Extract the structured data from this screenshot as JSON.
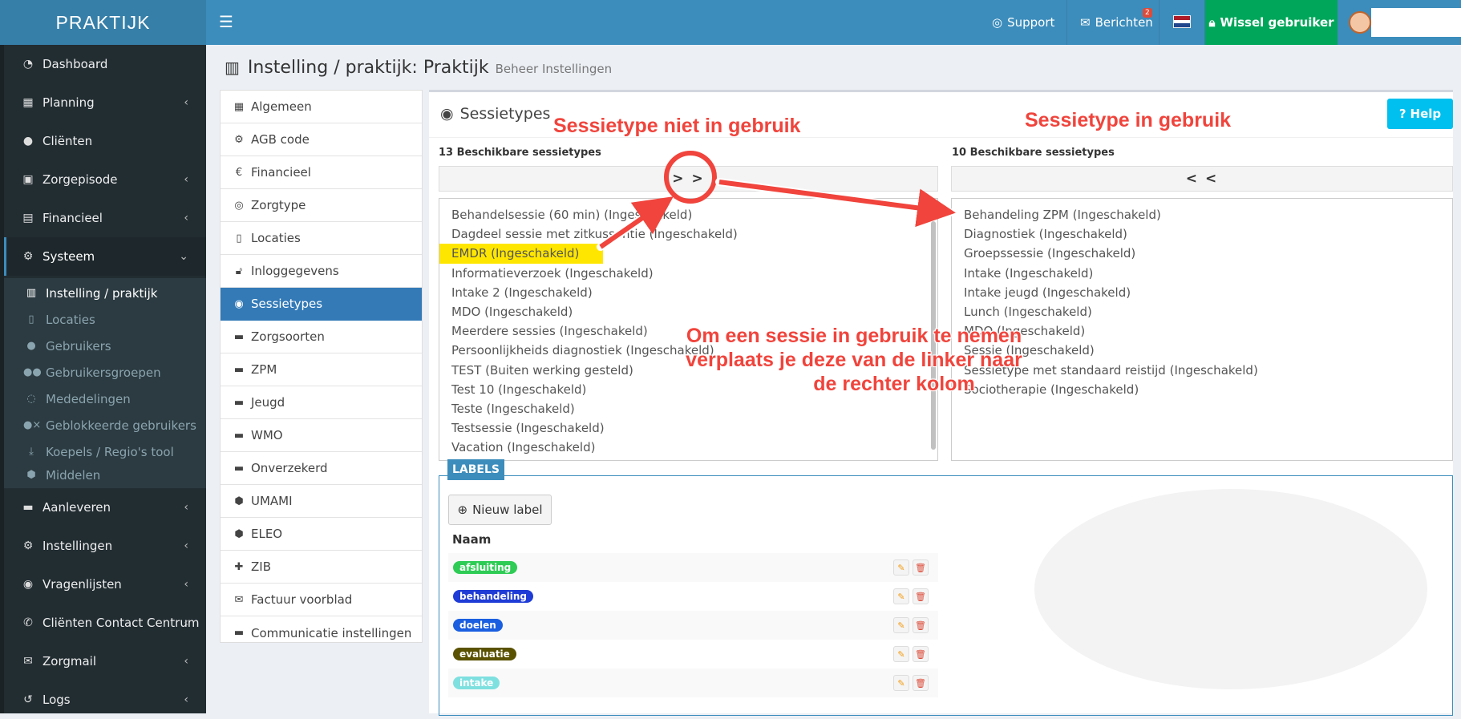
{
  "app": {
    "logo": "PRAKTIJK"
  },
  "topbar": {
    "support": "Support",
    "messages": "Berichten",
    "messages_badge": "2",
    "switch_user": "Wissel gebruiker"
  },
  "sidebar": {
    "items": [
      {
        "label": "Dashboard",
        "icon": "dashboard-icon"
      },
      {
        "label": "Planning",
        "icon": "calendar-icon"
      },
      {
        "label": "Cliënten",
        "icon": "user-icon"
      },
      {
        "label": "Zorgepisode",
        "icon": "briefcase-icon"
      },
      {
        "label": "Financieel",
        "icon": "book-icon"
      },
      {
        "label": "Systeem",
        "icon": "gears-icon"
      },
      {
        "label": "Aanleveren",
        "icon": "truck-icon"
      },
      {
        "label": "Instellingen",
        "icon": "gear-icon"
      },
      {
        "label": "Vragenlijsten",
        "icon": "globe-icon"
      },
      {
        "label": "Cliënten Contact Centrum",
        "icon": "phone-icon"
      },
      {
        "label": "Zorgmail",
        "icon": "envelope-icon"
      },
      {
        "label": "Logs",
        "icon": "history-icon"
      }
    ],
    "submenu": [
      {
        "label": "Instelling / praktijk",
        "icon": "building-icon"
      },
      {
        "label": "Locaties",
        "icon": "map-icon"
      },
      {
        "label": "Gebruikers",
        "icon": "user-icon"
      },
      {
        "label": "Gebruikersgroepen",
        "icon": "users-icon"
      },
      {
        "label": "Mededelingen",
        "icon": "comment-icon"
      },
      {
        "label": "Geblokkeerde gebruikers",
        "icon": "user-times-icon"
      },
      {
        "label": "Koepels / Regio's tool",
        "icon": "download-icon"
      },
      {
        "label": "Middelen",
        "icon": "cubes-icon"
      }
    ]
  },
  "header": {
    "title": "Instelling / praktijk: Praktijk",
    "subtitle": "Beheer Instellingen"
  },
  "settings_menu": [
    {
      "label": "Algemeen",
      "icon": "table-icon"
    },
    {
      "label": "AGB code",
      "icon": "gears-icon"
    },
    {
      "label": "Financieel",
      "icon": "euro-icon"
    },
    {
      "label": "Zorgtype",
      "icon": "universal-access-icon"
    },
    {
      "label": "Locaties",
      "icon": "map-icon"
    },
    {
      "label": "Inloggegevens",
      "icon": "unlock-icon"
    },
    {
      "label": "Sessietypes",
      "icon": "globe-icon"
    },
    {
      "label": "Zorgsoorten",
      "icon": "briefcase-icon"
    },
    {
      "label": "ZPM",
      "icon": "briefcase-icon"
    },
    {
      "label": "Jeugd",
      "icon": "briefcase-icon"
    },
    {
      "label": "WMO",
      "icon": "briefcase-icon"
    },
    {
      "label": "Onverzekerd",
      "icon": "briefcase-icon"
    },
    {
      "label": "UMAMI",
      "icon": "cubes-icon"
    },
    {
      "label": "ELEO",
      "icon": "cubes-icon"
    },
    {
      "label": "ZIB",
      "icon": "puzzle-icon"
    },
    {
      "label": "Factuur voorblad",
      "icon": "envelope-icon"
    },
    {
      "label": "Communicatie instellingen",
      "icon": "briefcase-icon"
    }
  ],
  "sessietypes": {
    "title": "Sessietypes",
    "help": "Help",
    "available": {
      "heading": "13 Beschikbare sessietypes",
      "button": "> >",
      "options": [
        "Behandelsessie (60 min) (Ingeschakeld)",
        "Dagdeel sessie met zitkussentie (Ingeschakeld)",
        "EMDR (Ingeschakeld)",
        "Informatieverzoek (Ingeschakeld)",
        "Intake 2 (Ingeschakeld)",
        "MDO (Ingeschakeld)",
        "Meerdere sessies (Ingeschakeld)",
        "Persoonlijkheids diagnostiek (Ingeschakeld)",
        "TEST (Buiten werking gesteld)",
        "Test 10 (Ingeschakeld)",
        "Teste (Ingeschakeld)",
        "Testsessie (Ingeschakeld)",
        "Vacation (Ingeschakeld)"
      ]
    },
    "selected": {
      "heading": "10 Beschikbare sessietypes",
      "button": "< <",
      "options": [
        "Behandeling ZPM (Ingeschakeld)",
        "Diagnostiek (Ingeschakeld)",
        "Groepssessie (Ingeschakeld)",
        "Intake (Ingeschakeld)",
        "Intake jeugd (Ingeschakeld)",
        "Lunch (Ingeschakeld)",
        "MDO (Ingeschakeld)",
        "Sessie (Ingeschakeld)",
        "Sessietype met standaard reistijd (Ingeschakeld)",
        "Sociotherapie (Ingeschakeld)"
      ]
    }
  },
  "labels": {
    "tag": "LABELS",
    "new_button": "Nieuw label",
    "column": "Naam",
    "rows": [
      {
        "name": "afsluiting",
        "color": "#2ecc55"
      },
      {
        "name": "behandeling",
        "color": "#1f3cd6"
      },
      {
        "name": "doelen",
        "color": "#1a5fe0"
      },
      {
        "name": "evaluatie",
        "color": "#5a5200"
      },
      {
        "name": "intake",
        "color": "#7fe0e0"
      }
    ]
  },
  "annotations": {
    "left": "Sessietype niet in gebruik",
    "right": "Sessietype in gebruik",
    "note_line1": "Om een sessie in gebruik te nemen",
    "note_line2": "verplaats je deze van de linker naar",
    "note_line3": "de rechter kolom",
    "color": "#f0443c"
  }
}
